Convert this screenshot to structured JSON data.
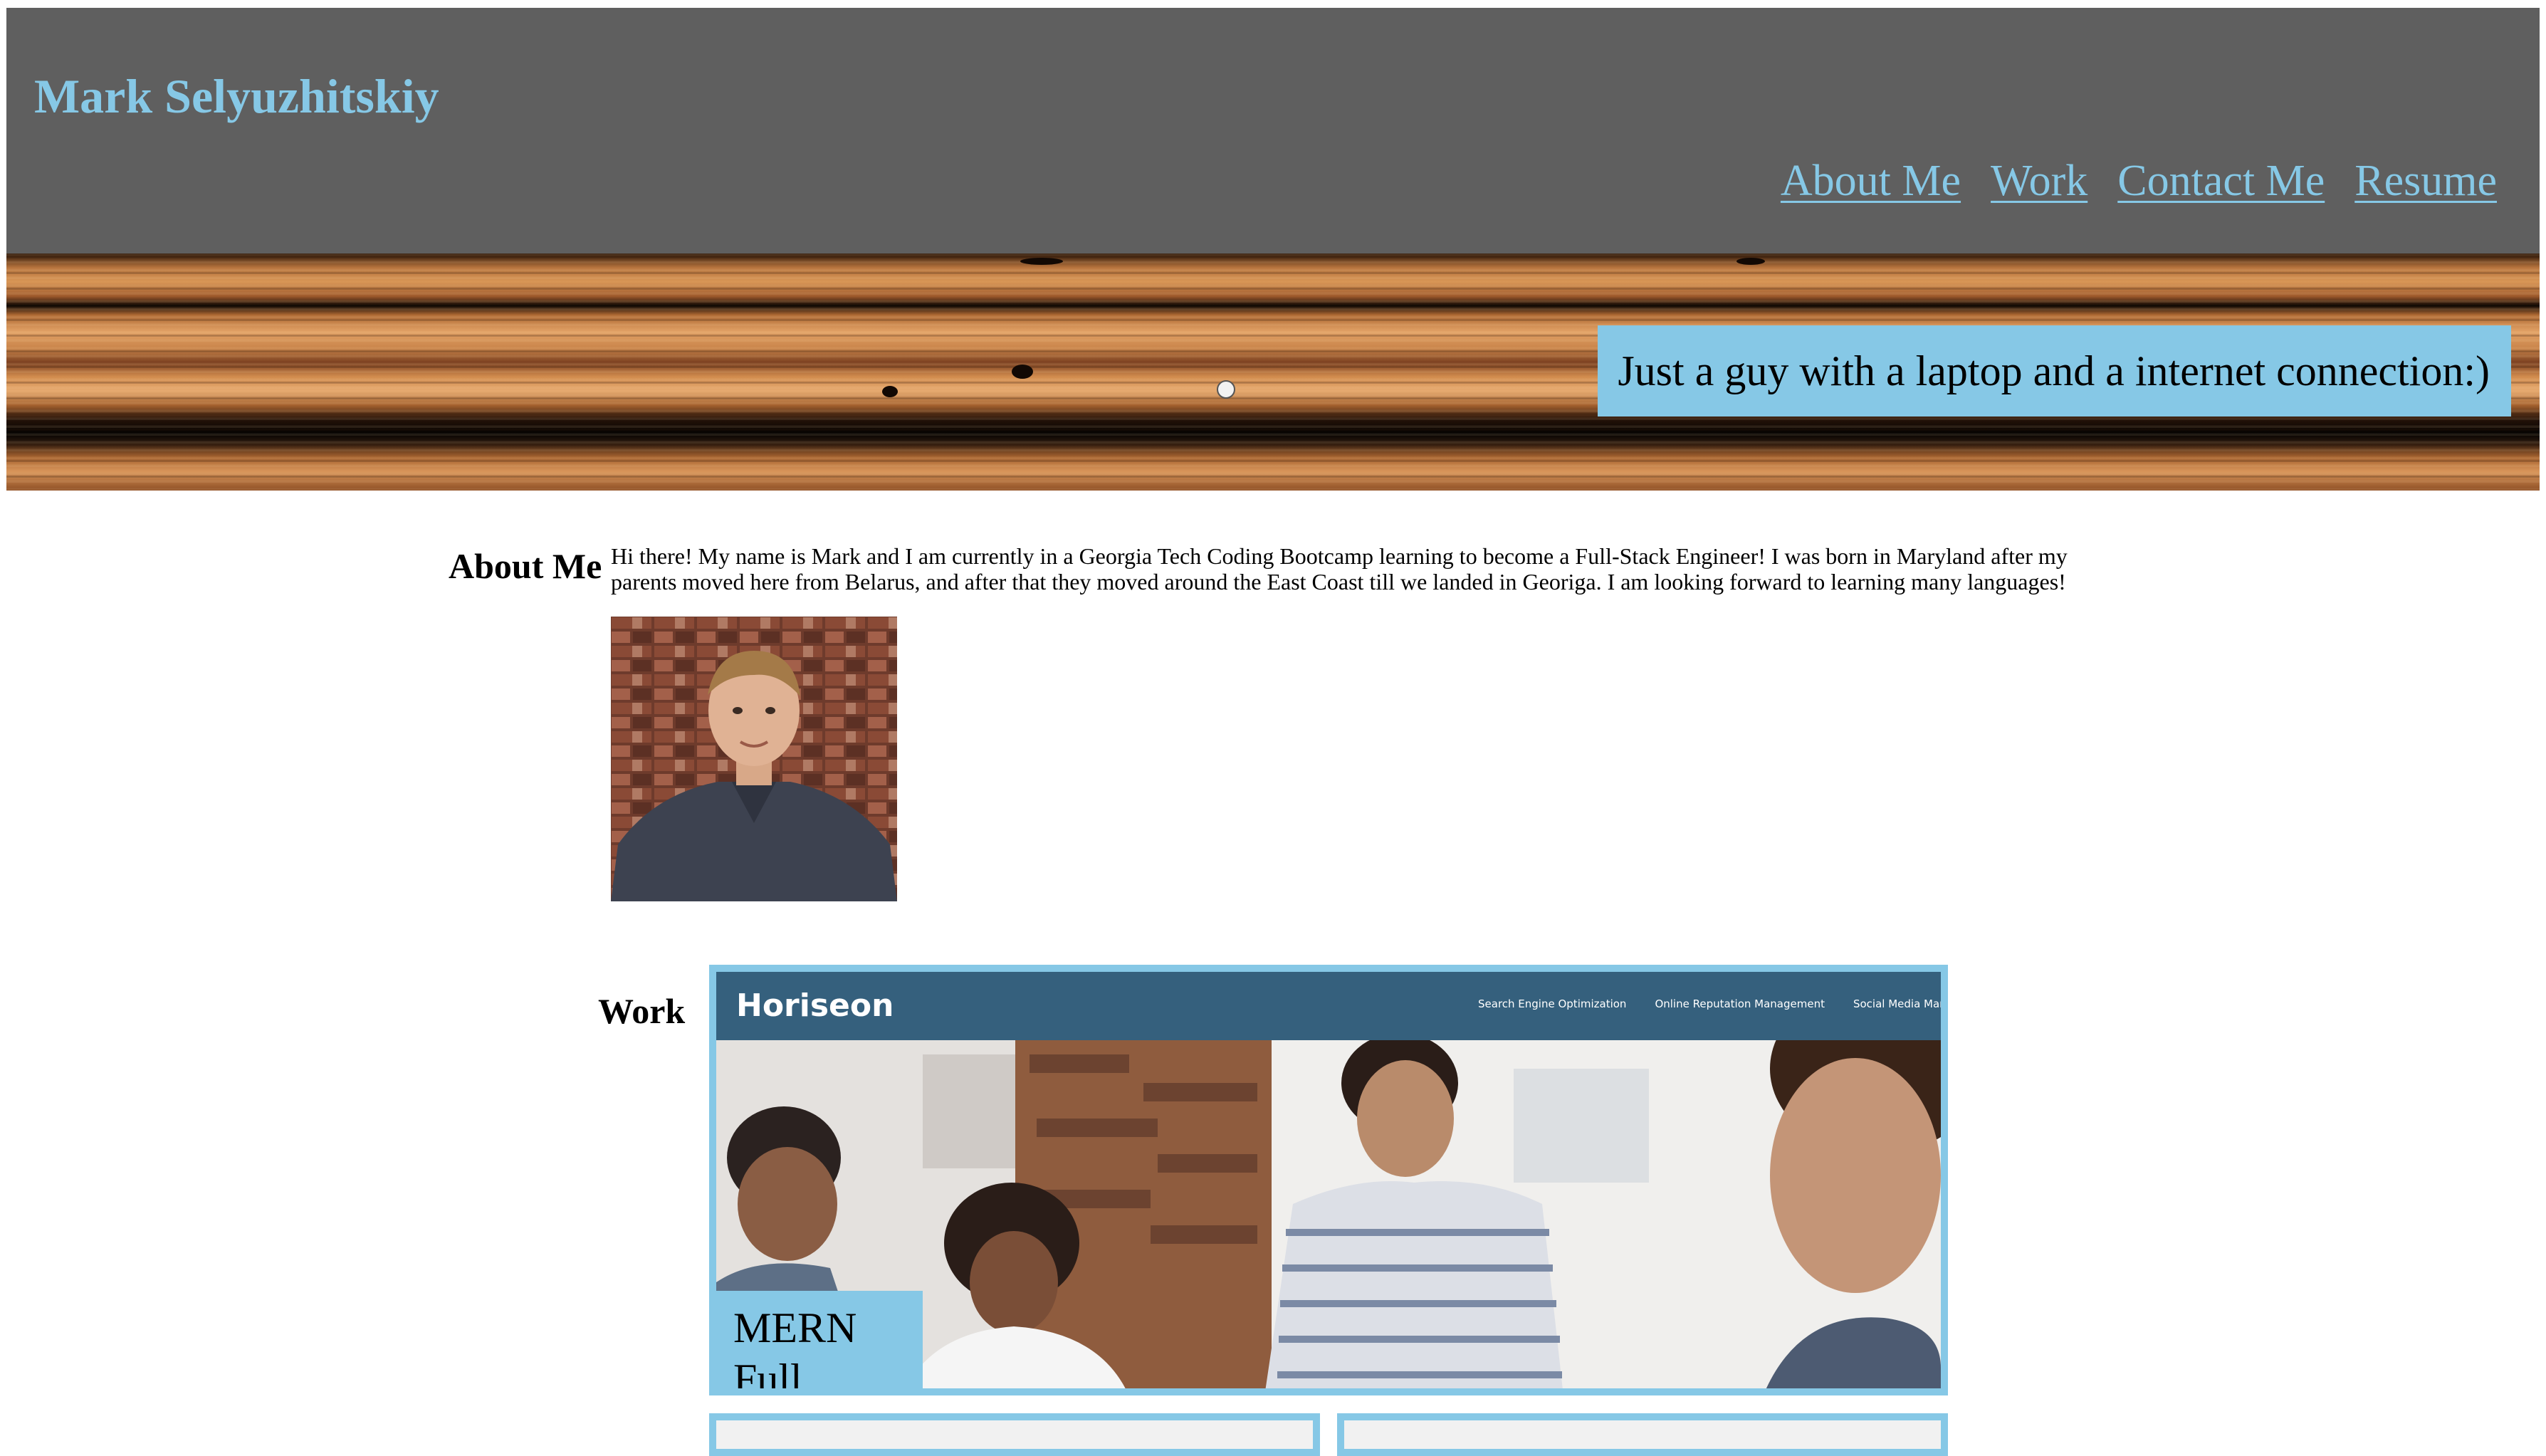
{
  "header": {
    "site_title": "Mark Selyuzhitskiy",
    "nav": [
      {
        "label": "About Me"
      },
      {
        "label": "Work"
      },
      {
        "label": "Contact Me"
      },
      {
        "label": "Resume"
      }
    ]
  },
  "hero": {
    "tagline": "Just a guy with a laptop and a internet connection:)"
  },
  "about": {
    "heading": "About Me",
    "text": "Hi there! My name is Mark and I am currently in a Georgia Tech Coding Bootcamp learning to become a Full-Stack Engineer! I was born in Maryland after my parents moved here from Belarus, and after that they moved around the East Coast till we landed in Georiga. I am looking forward to learning many languages!"
  },
  "work": {
    "heading": "Work",
    "featured_project": {
      "screenshot_brand": "Horiseon",
      "screenshot_nav": [
        "Search Engine Optimization",
        "Online Reputation Management",
        "Social Media Market"
      ],
      "label_line1": "MERN",
      "label_line2": "Full Stack"
    }
  },
  "colors": {
    "accent": "#86c8e6",
    "header_bg": "#5f5f5f",
    "project_nav_bg": "#35607d"
  }
}
